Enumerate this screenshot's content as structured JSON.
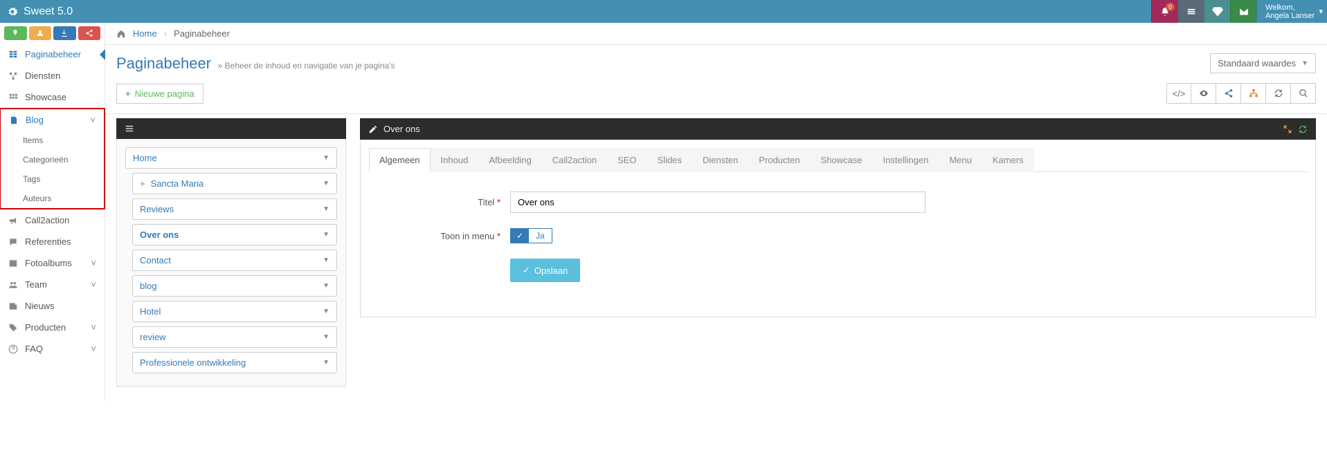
{
  "brand": "Sweet 5.0",
  "notifications": {
    "count": "0"
  },
  "welcome": {
    "greeting": "Welkom,",
    "name": "Angela Lanser"
  },
  "breadcrumbs": {
    "home": "Home",
    "current": "Paginabeheer"
  },
  "page": {
    "title": "Paginabeheer",
    "subtitle": "» Beheer de inhoud en navigatie van je pagina's",
    "std_values": "Standaard waardes",
    "new_page": "Nieuwe pagina"
  },
  "sidebar": {
    "items": [
      {
        "label": "Paginabeheer"
      },
      {
        "label": "Diensten"
      },
      {
        "label": "Showcase"
      },
      {
        "label": "Blog"
      },
      {
        "label": "Call2action"
      },
      {
        "label": "Referenties"
      },
      {
        "label": "Fotoalbums"
      },
      {
        "label": "Team"
      },
      {
        "label": "Nieuws"
      },
      {
        "label": "Producten"
      },
      {
        "label": "FAQ"
      }
    ],
    "blog_sub": [
      {
        "label": "Items"
      },
      {
        "label": "Categorieën"
      },
      {
        "label": "Tags"
      },
      {
        "label": "Auteurs"
      }
    ]
  },
  "panels": {
    "right_title": "Over ons"
  },
  "tree": [
    {
      "label": "Home"
    },
    {
      "label": "Sancta Maria",
      "expandable": true
    },
    {
      "label": "Reviews"
    },
    {
      "label": "Over ons",
      "selected": true
    },
    {
      "label": "Contact"
    },
    {
      "label": "blog"
    },
    {
      "label": "Hotel"
    },
    {
      "label": "review"
    },
    {
      "label": "Professionele ontwikkeling"
    }
  ],
  "tabs": [
    "Algemeen",
    "Inhoud",
    "Afbeelding",
    "Call2action",
    "SEO",
    "Slides",
    "Diensten",
    "Producten",
    "Showcase",
    "Instellingen",
    "Menu",
    "Kamers"
  ],
  "form": {
    "title_label": "Titel",
    "title_value": "Over ons",
    "menu_label": "Toon in menu",
    "menu_value": "Ja",
    "save": "Opslaan"
  }
}
